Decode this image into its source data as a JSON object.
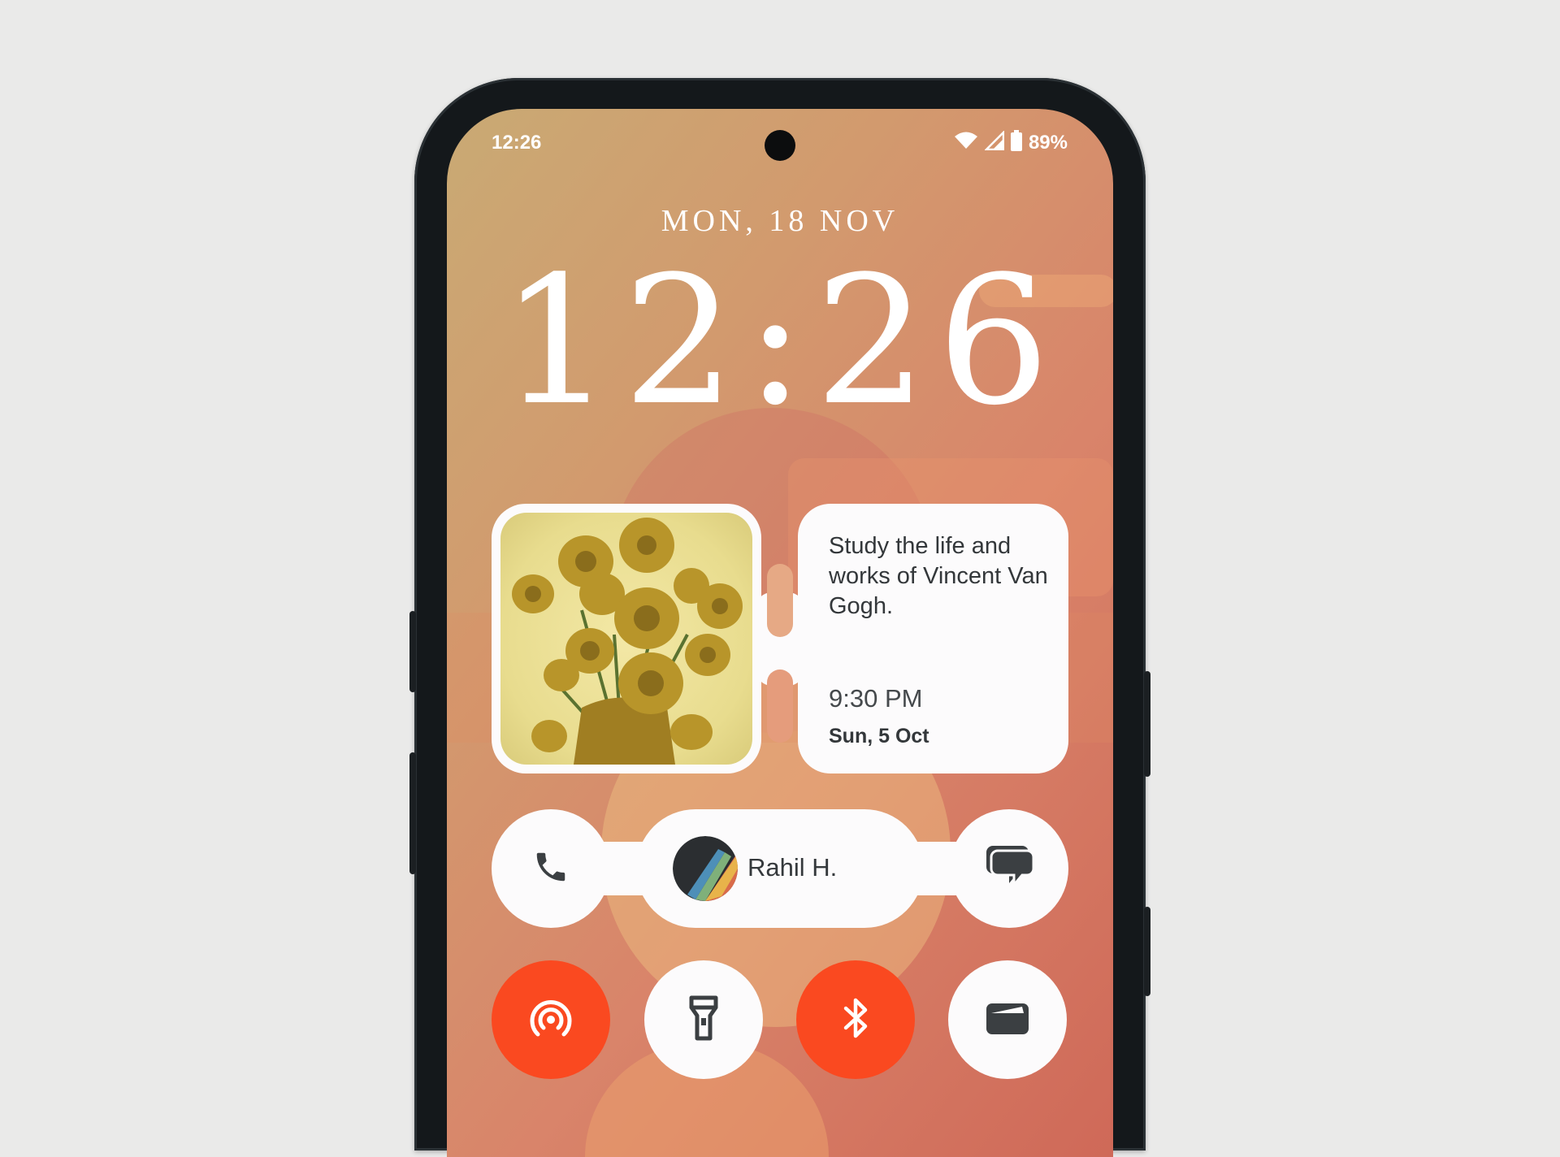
{
  "status_bar": {
    "time": "12:26",
    "battery": "89%"
  },
  "lockscreen": {
    "date": "MON, 18 NOV",
    "clock": "12:26"
  },
  "reminder": {
    "text": "Study the life and works of Vincent Van Gogh.",
    "time": "9:30 PM",
    "date": "Sun, 5 Oct"
  },
  "contact": {
    "name": "Rahil H."
  },
  "quick_settings": [
    {
      "name": "hotspot",
      "icon": "hotspot-icon",
      "active": true
    },
    {
      "name": "flashlight",
      "icon": "flashlight-icon",
      "active": false
    },
    {
      "name": "bluetooth",
      "icon": "bluetooth-icon",
      "active": true
    },
    {
      "name": "wallet",
      "icon": "wallet-icon",
      "active": false
    }
  ],
  "colors": {
    "accent": "#fa4920",
    "tile": "#fcfbfc",
    "icon": "#3b3f42"
  }
}
